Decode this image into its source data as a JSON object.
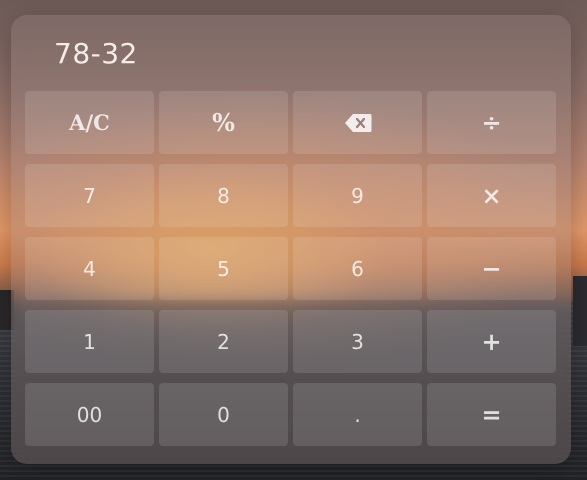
{
  "display": {
    "expression": "78-32"
  },
  "keys": [
    {
      "name": "key-all-clear",
      "label": "A/C",
      "icon": ""
    },
    {
      "name": "key-percent",
      "label": "%",
      "icon": ""
    },
    {
      "name": "key-backspace",
      "label": "",
      "icon": "backspace-icon"
    },
    {
      "name": "key-divide",
      "label": "÷",
      "icon": ""
    },
    {
      "name": "key-7",
      "label": "7",
      "icon": ""
    },
    {
      "name": "key-8",
      "label": "8",
      "icon": ""
    },
    {
      "name": "key-9",
      "label": "9",
      "icon": ""
    },
    {
      "name": "key-multiply",
      "label": "×",
      "icon": ""
    },
    {
      "name": "key-4",
      "label": "4",
      "icon": ""
    },
    {
      "name": "key-5",
      "label": "5",
      "icon": ""
    },
    {
      "name": "key-6",
      "label": "6",
      "icon": ""
    },
    {
      "name": "key-minus",
      "label": "−",
      "icon": ""
    },
    {
      "name": "key-1",
      "label": "1",
      "icon": ""
    },
    {
      "name": "key-2",
      "label": "2",
      "icon": ""
    },
    {
      "name": "key-3",
      "label": "3",
      "icon": ""
    },
    {
      "name": "key-plus",
      "label": "+",
      "icon": ""
    },
    {
      "name": "key-double-zero",
      "label": "00",
      "icon": ""
    },
    {
      "name": "key-0",
      "label": "0",
      "icon": ""
    },
    {
      "name": "key-decimal",
      "label": ".",
      "icon": ""
    },
    {
      "name": "key-equals",
      "label": "=",
      "icon": ""
    }
  ]
}
